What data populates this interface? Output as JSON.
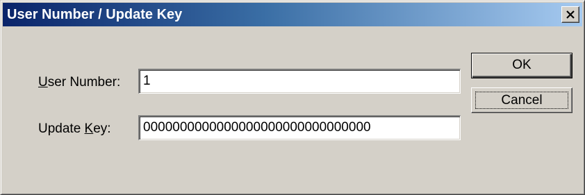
{
  "window": {
    "title": "User Number / Update Key",
    "close_icon": "close-x-icon"
  },
  "form": {
    "user_number": {
      "label_accel": "U",
      "label_rest": "ser Number:",
      "value": "1"
    },
    "update_key": {
      "label_pre": "Update ",
      "label_accel": "K",
      "label_post": "ey:",
      "value": "0000000000000000000000000000000"
    }
  },
  "buttons": {
    "ok_label": "OK",
    "cancel_label": "Cancel"
  }
}
